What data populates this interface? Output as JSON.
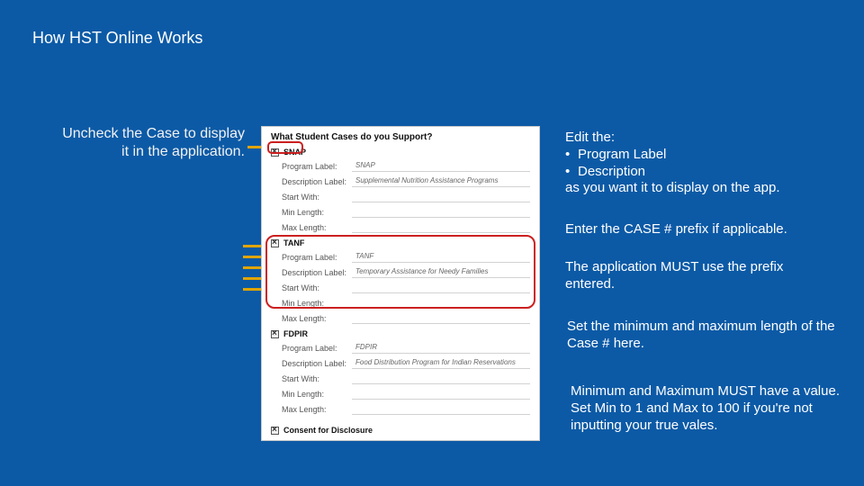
{
  "title": "How HST Online Works",
  "leftNote": {
    "line1": "Uncheck the Case to display",
    "line2": "it in the application."
  },
  "form": {
    "header": "What Student Cases do you Support?",
    "labels": {
      "programLabel": "Program Label:",
      "descriptionLabel": "Description Label:",
      "startWith": "Start With:",
      "minLength": "Min Length:",
      "maxLength": "Max Length:"
    },
    "sections": {
      "snap": {
        "name": "SNAP",
        "programLabel": "SNAP",
        "description": "Supplemental Nutrition Assistance Programs",
        "startWith": "",
        "minLength": "",
        "maxLength": ""
      },
      "tanf": {
        "name": "TANF",
        "programLabel": "TANF",
        "description": "Temporary Assistance for Needy Families",
        "startWith": "",
        "minLength": "",
        "maxLength": ""
      },
      "fdpir": {
        "name": "FDPIR",
        "programLabel": "FDPIR",
        "description": "Food Distribution Program for Indian Reservations",
        "startWith": "",
        "minLength": "",
        "maxLength": ""
      }
    },
    "consent": "Consent for Disclosure"
  },
  "callouts": {
    "c1": {
      "line1": "Edit the:",
      "b1": "Program Label",
      "b2": "Description",
      "line2": "as you want it to display on the app."
    },
    "c2": "Enter the CASE # prefix if applicable.",
    "c3": "The application MUST use the prefix entered.",
    "c4": "Set the minimum and maximum length of the Case # here.",
    "c5": "Minimum and Maximum MUST have a value. Set Min to 1 and Max to 100 if you're not inputting your true vales."
  }
}
